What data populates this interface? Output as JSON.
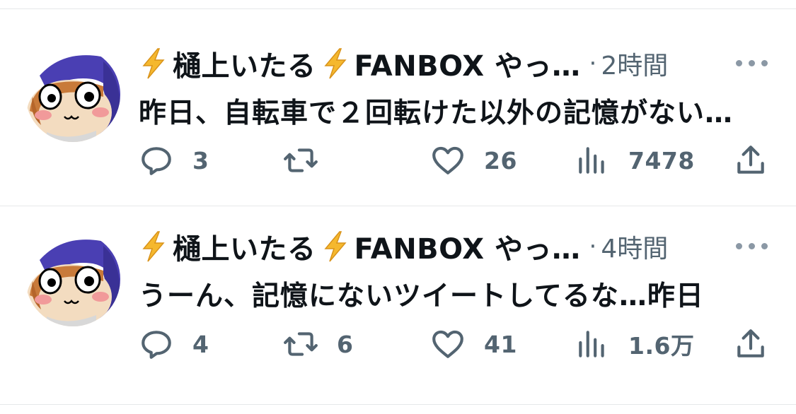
{
  "colors": {
    "text": "#0f1419",
    "muted": "#536471",
    "divider": "#e6e8ea",
    "bolt": "#f5b82e"
  },
  "tweets": [
    {
      "author": {
        "name_main": "樋上いたる",
        "name_rest": "FANBOX やっ…",
        "prefix_icon": "lightning-bolt-emoji",
        "avatar": "anime-character-avatar"
      },
      "time": "2時間",
      "text": "昨日、自転車で２回転けた以外の記憶がない…",
      "replies": "3",
      "retweets": "",
      "likes": "26",
      "views": "7478"
    },
    {
      "author": {
        "name_main": "樋上いたる",
        "name_rest": "FANBOX やっ…",
        "prefix_icon": "lightning-bolt-emoji",
        "avatar": "anime-character-avatar"
      },
      "time": "4時間",
      "text": "うーん、記憶にないツイートしてるな…昨日",
      "replies": "4",
      "retweets": "6",
      "likes": "41",
      "views": "1.6万"
    }
  ]
}
